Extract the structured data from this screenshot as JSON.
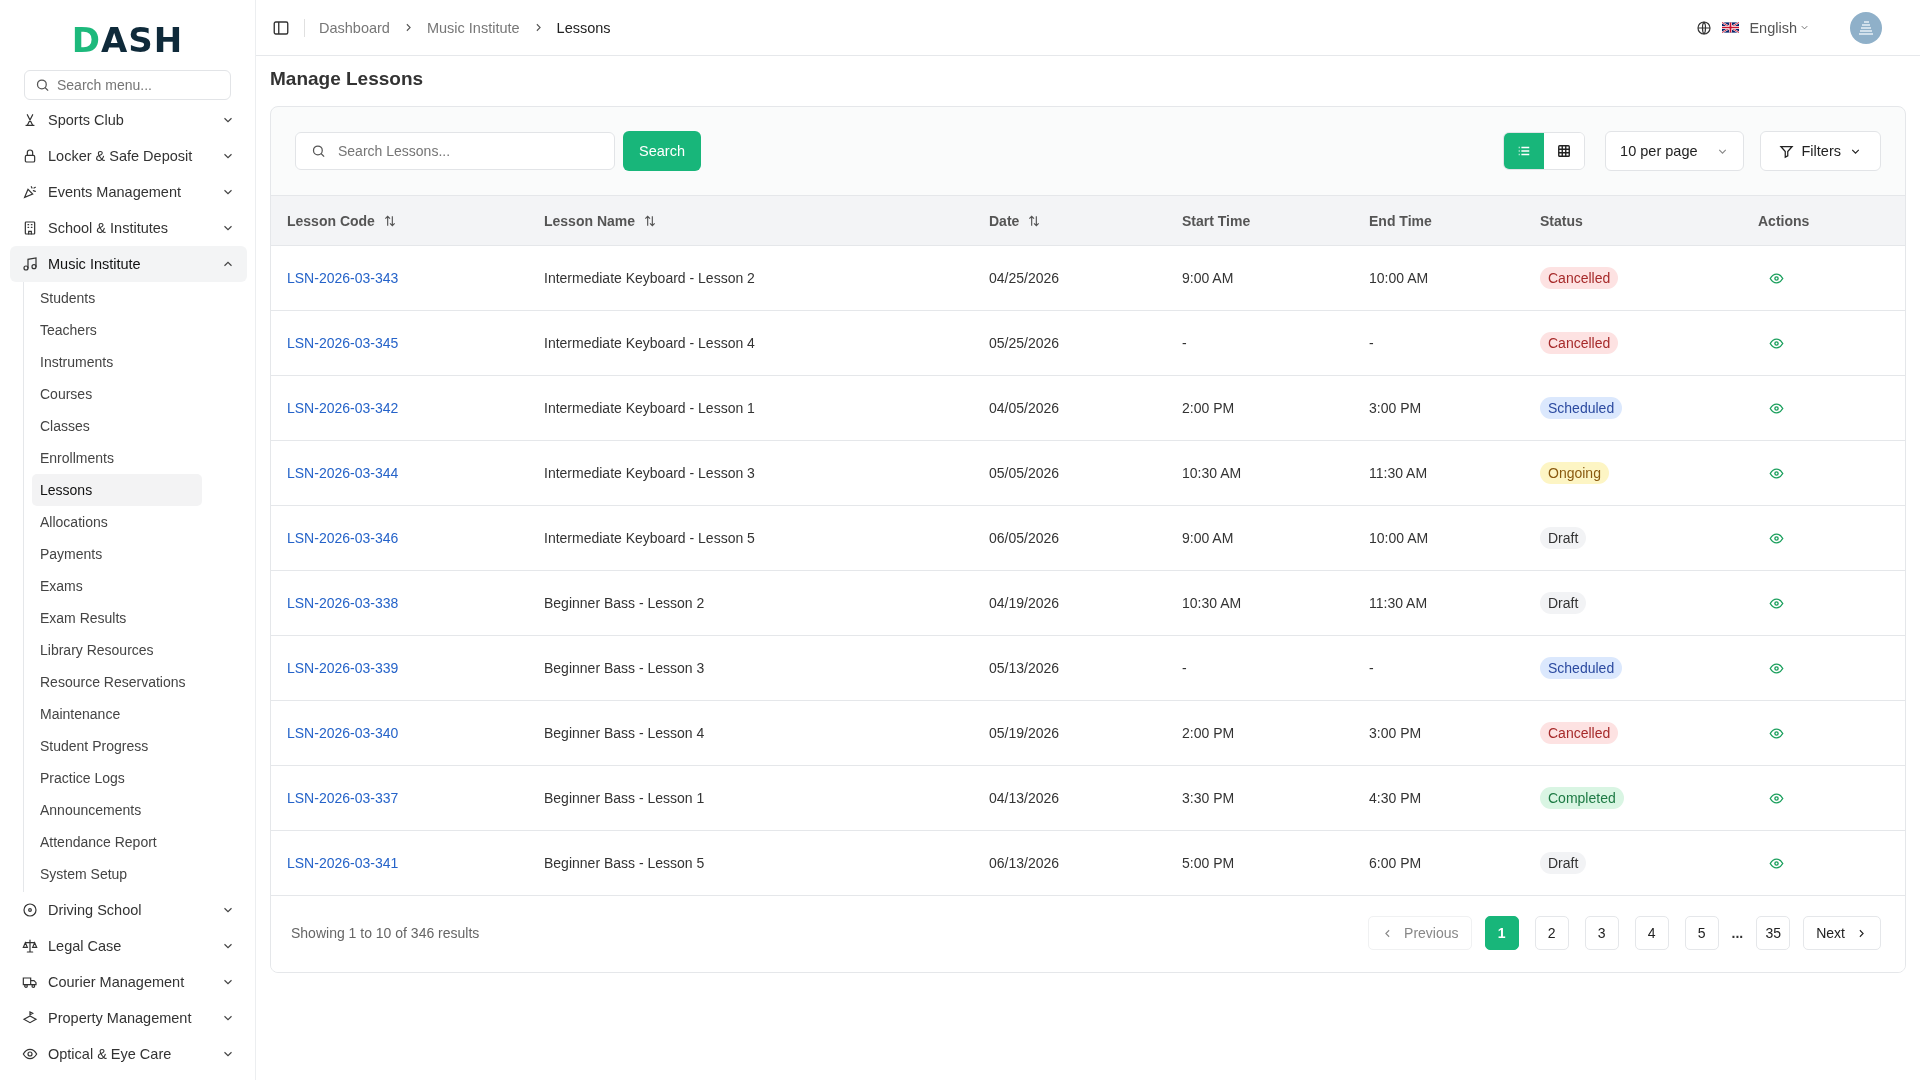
{
  "sidebar": {
    "logo": "DASH",
    "search": {
      "placeholder": "Search menu..."
    },
    "items": [
      {
        "label": "Sports Club",
        "expanded": false,
        "selected": false
      },
      {
        "label": "Locker & Safe Deposit",
        "expanded": false,
        "selected": false
      },
      {
        "label": "Events Management",
        "expanded": false,
        "selected": false
      },
      {
        "label": "School & Institutes",
        "expanded": false,
        "selected": false
      },
      {
        "label": "Music Institute",
        "expanded": true,
        "selected": true,
        "children": [
          {
            "label": "Students",
            "selected": false
          },
          {
            "label": "Teachers",
            "selected": false
          },
          {
            "label": "Instruments",
            "selected": false
          },
          {
            "label": "Courses",
            "selected": false
          },
          {
            "label": "Classes",
            "selected": false
          },
          {
            "label": "Enrollments",
            "selected": false
          },
          {
            "label": "Lessons",
            "selected": true
          },
          {
            "label": "Allocations",
            "selected": false
          },
          {
            "label": "Payments",
            "selected": false
          },
          {
            "label": "Exams",
            "selected": false
          },
          {
            "label": "Exam Results",
            "selected": false
          },
          {
            "label": "Library Resources",
            "selected": false
          },
          {
            "label": "Resource Reservations",
            "selected": false
          },
          {
            "label": "Maintenance",
            "selected": false
          },
          {
            "label": "Student Progress",
            "selected": false
          },
          {
            "label": "Practice Logs",
            "selected": false
          },
          {
            "label": "Announcements",
            "selected": false
          },
          {
            "label": "Attendance Report",
            "selected": false
          },
          {
            "label": "System Setup",
            "selected": false
          }
        ]
      },
      {
        "label": "Driving School",
        "expanded": false,
        "selected": false
      },
      {
        "label": "Legal Case",
        "expanded": false,
        "selected": false
      },
      {
        "label": "Courier Management",
        "expanded": false,
        "selected": false
      },
      {
        "label": "Property Management",
        "expanded": false,
        "selected": false
      },
      {
        "label": "Optical & Eye Care",
        "expanded": false,
        "selected": false
      }
    ]
  },
  "breadcrumb": [
    "Dashboard",
    "Music Institute",
    "Lessons"
  ],
  "language": "English",
  "page_title": "Manage Lessons",
  "toolbar": {
    "search": {
      "placeholder": "Search Lessons..."
    },
    "search_button": "Search",
    "views": [
      {
        "kind": "list",
        "selected": true
      },
      {
        "kind": "grid",
        "selected": false
      }
    ],
    "per_page": "10 per page",
    "filters": "Filters"
  },
  "table": {
    "columns": [
      {
        "label": "Lesson Code",
        "sortable": true
      },
      {
        "label": "Lesson Name",
        "sortable": true
      },
      {
        "label": "Date",
        "sortable": true
      },
      {
        "label": "Start Time",
        "sortable": false
      },
      {
        "label": "End Time",
        "sortable": false
      },
      {
        "label": "Status",
        "sortable": false
      },
      {
        "label": "Actions",
        "sortable": false
      }
    ],
    "rows": [
      {
        "code": "LSN-2026-03-343",
        "name": "Intermediate Keyboard - Lesson 2",
        "date": "04/25/2026",
        "start": "9:00 AM",
        "end": "10:00 AM",
        "status": {
          "label": "Cancelled",
          "kind": "cancelled"
        }
      },
      {
        "code": "LSN-2026-03-345",
        "name": "Intermediate Keyboard - Lesson 4",
        "date": "05/25/2026",
        "start": "-",
        "end": "-",
        "status": {
          "label": "Cancelled",
          "kind": "cancelled"
        }
      },
      {
        "code": "LSN-2026-03-342",
        "name": "Intermediate Keyboard - Lesson 1",
        "date": "04/05/2026",
        "start": "2:00 PM",
        "end": "3:00 PM",
        "status": {
          "label": "Scheduled",
          "kind": "scheduled"
        }
      },
      {
        "code": "LSN-2026-03-344",
        "name": "Intermediate Keyboard - Lesson 3",
        "date": "05/05/2026",
        "start": "10:30 AM",
        "end": "11:30 AM",
        "status": {
          "label": "Ongoing",
          "kind": "ongoing"
        }
      },
      {
        "code": "LSN-2026-03-346",
        "name": "Intermediate Keyboard - Lesson 5",
        "date": "06/05/2026",
        "start": "9:00 AM",
        "end": "10:00 AM",
        "status": {
          "label": "Draft",
          "kind": "draft"
        }
      },
      {
        "code": "LSN-2026-03-338",
        "name": "Beginner Bass - Lesson 2",
        "date": "04/19/2026",
        "start": "10:30 AM",
        "end": "11:30 AM",
        "status": {
          "label": "Draft",
          "kind": "draft"
        }
      },
      {
        "code": "LSN-2026-03-339",
        "name": "Beginner Bass - Lesson 3",
        "date": "05/13/2026",
        "start": "-",
        "end": "-",
        "status": {
          "label": "Scheduled",
          "kind": "scheduled"
        }
      },
      {
        "code": "LSN-2026-03-340",
        "name": "Beginner Bass - Lesson 4",
        "date": "05/19/2026",
        "start": "2:00 PM",
        "end": "3:00 PM",
        "status": {
          "label": "Cancelled",
          "kind": "cancelled"
        }
      },
      {
        "code": "LSN-2026-03-337",
        "name": "Beginner Bass - Lesson 1",
        "date": "04/13/2026",
        "start": "3:30 PM",
        "end": "4:30 PM",
        "status": {
          "label": "Completed",
          "kind": "completed"
        }
      },
      {
        "code": "LSN-2026-03-341",
        "name": "Beginner Bass - Lesson 5",
        "date": "06/13/2026",
        "start": "5:00 PM",
        "end": "6:00 PM",
        "status": {
          "label": "Draft",
          "kind": "draft"
        }
      }
    ]
  },
  "footer": {
    "summary": "Showing 1 to 10 of 346 results",
    "previous": {
      "label": "Previous",
      "disabled": true
    },
    "pages": [
      {
        "label": "1",
        "selected": true
      },
      {
        "label": "2",
        "selected": false
      },
      {
        "label": "3",
        "selected": false
      },
      {
        "label": "4",
        "selected": false
      },
      {
        "label": "5",
        "selected": false
      },
      {
        "label": "...",
        "kind": "ellipsis"
      },
      {
        "label": "35",
        "selected": false
      }
    ],
    "next": {
      "label": "Next",
      "disabled": false
    }
  }
}
